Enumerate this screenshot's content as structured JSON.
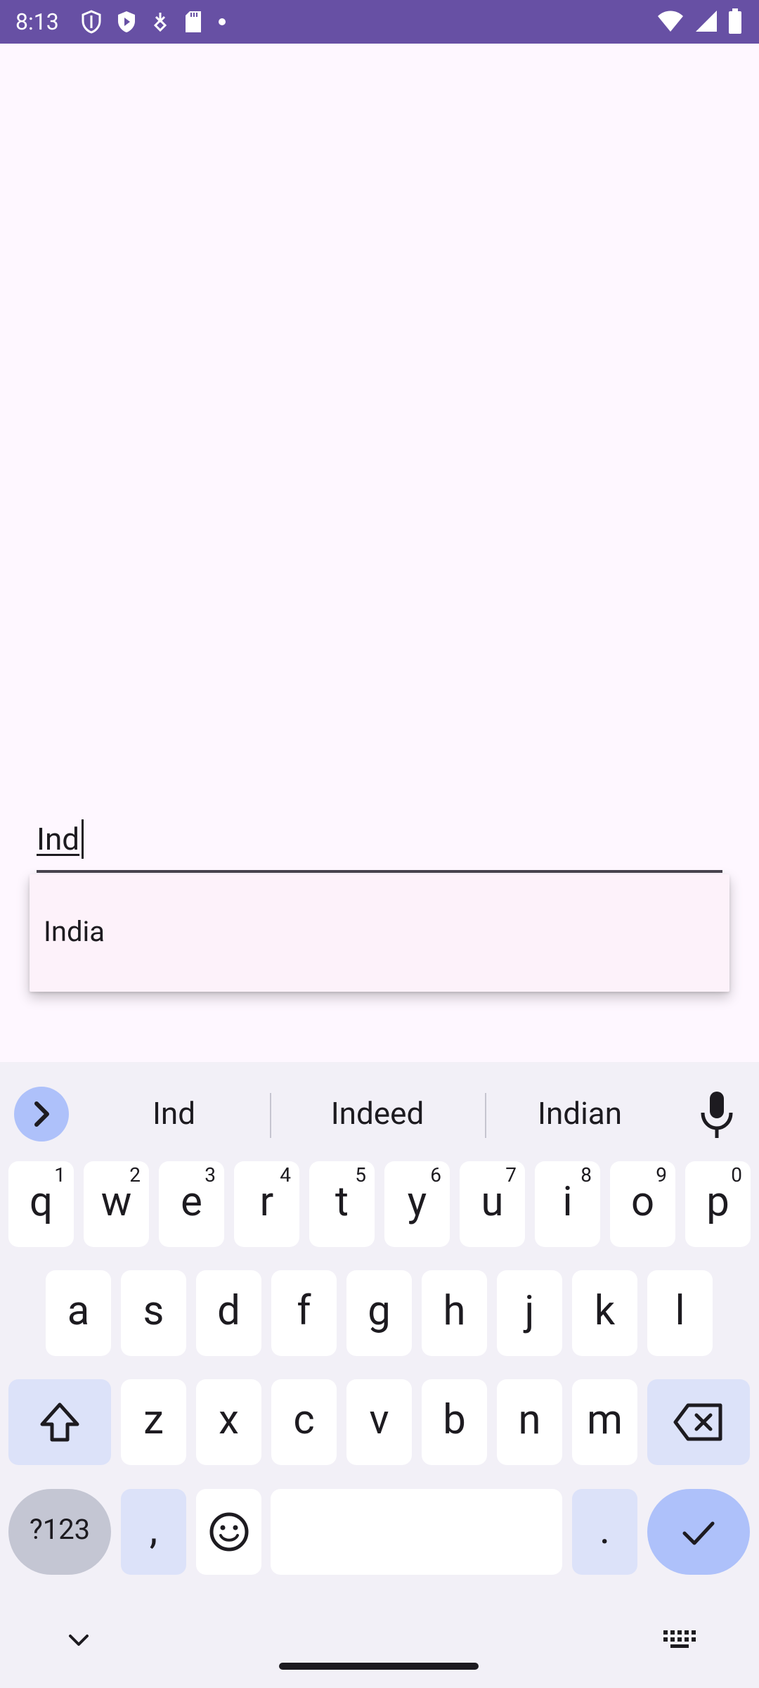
{
  "status_bar": {
    "time": "8:13",
    "icons_left": [
      "shield-icon",
      "play-shield-icon",
      "vpn-key-icon",
      "sd-card-icon",
      "dot-icon"
    ],
    "icons_right": [
      "wifi-icon",
      "signal-icon",
      "battery-icon"
    ],
    "color": "#6750A4"
  },
  "search_field": {
    "value": "Ind"
  },
  "dropdown": {
    "items": [
      "India"
    ]
  },
  "keyboard": {
    "suggestions": [
      "Ind",
      "Indeed",
      "Indian"
    ],
    "row1": [
      {
        "key": "q",
        "num": "1"
      },
      {
        "key": "w",
        "num": "2"
      },
      {
        "key": "e",
        "num": "3"
      },
      {
        "key": "r",
        "num": "4"
      },
      {
        "key": "t",
        "num": "5"
      },
      {
        "key": "y",
        "num": "6"
      },
      {
        "key": "u",
        "num": "7"
      },
      {
        "key": "i",
        "num": "8"
      },
      {
        "key": "o",
        "num": "9"
      },
      {
        "key": "p",
        "num": "0"
      }
    ],
    "row2": [
      "a",
      "s",
      "d",
      "f",
      "g",
      "h",
      "j",
      "k",
      "l"
    ],
    "row3": [
      "z",
      "x",
      "c",
      "v",
      "b",
      "n",
      "m"
    ],
    "symbols_label": "?123",
    "comma": ",",
    "period": ".",
    "accent_color": "#AEC1FA"
  }
}
